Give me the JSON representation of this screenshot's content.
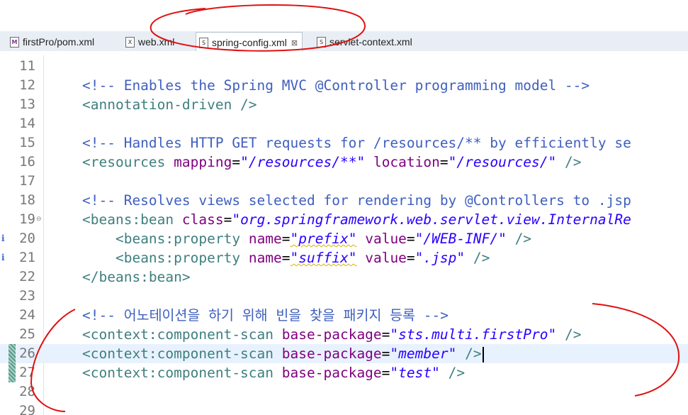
{
  "tabs": [
    {
      "label": "firstPro/pom.xml",
      "icon": "maven-pom-icon",
      "icon_glyph": "M"
    },
    {
      "label": "web.xml",
      "icon": "xml-file-icon",
      "icon_glyph": "X"
    },
    {
      "label": "spring-config.xml",
      "icon": "spring-xml-icon",
      "icon_glyph": "S",
      "active": true,
      "close": "⊠"
    },
    {
      "label": "servlet-context.xml",
      "icon": "spring-xml-icon",
      "icon_glyph": "S"
    }
  ],
  "editor": {
    "lines": [
      {
        "n": "11"
      },
      {
        "n": "12",
        "comment": "<!-- Enables the Spring MVC @Controller programming model -->"
      },
      {
        "n": "13",
        "tag": "<annotation-driven />"
      },
      {
        "n": "14"
      },
      {
        "n": "15",
        "comment": "<!-- Handles HTTP GET requests for /resources/** by efficiently se"
      },
      {
        "n": "16",
        "tag_open": "<resources",
        "a1": "mapping",
        "v1": "\"/resources/**\"",
        "a2": "location",
        "v2": "\"/resources/\"",
        "end": "/>"
      },
      {
        "n": "17"
      },
      {
        "n": "18",
        "comment": "<!-- Resolves views selected for rendering by @Controllers to .jsp"
      },
      {
        "n": "19",
        "tag_open": "<beans:bean",
        "a1": "class",
        "v1": "\"org.springframework.web.servlet.view.InternalRe"
      },
      {
        "n": "20",
        "tag_open": "<beans:property",
        "a1": "name",
        "v1": "\"prefix\"",
        "a2": "value",
        "v2": "\"/WEB-INF/\"",
        "end": "/>"
      },
      {
        "n": "21",
        "tag_open": "<beans:property",
        "a1": "name",
        "v1": "\"suffix\"",
        "a2": "value",
        "v2": "\".jsp\"",
        "end": "/>"
      },
      {
        "n": "22",
        "tag": "</beans:bean>"
      },
      {
        "n": "23"
      },
      {
        "n": "24",
        "comment": "<!-- 어노테이션을 하기 위해 빈을 찾을 패키지 등록 -->"
      },
      {
        "n": "25",
        "tag_open": "<context:component-scan",
        "a1": "base-package",
        "v1": "\"sts.multi.firstPro\"",
        "end": "/>"
      },
      {
        "n": "26",
        "tag_open": "<context:component-scan",
        "a1": "base-package",
        "v1": "\"member\"",
        "end": "/>"
      },
      {
        "n": "27",
        "tag_open": "<context:component-scan",
        "a1": "base-package",
        "v1": "\"test\"",
        "end": "/>"
      },
      {
        "n": "28"
      },
      {
        "n": "29"
      }
    ],
    "info_marker": "i",
    "fold_marker": "⊖"
  },
  "colors": {
    "tag": "#3f7f7f",
    "attribute": "#7f007f",
    "value": "#2a00ff",
    "comment": "#3f5fbf",
    "current_line": "#e8f2fe",
    "annotation": "#e01010"
  }
}
